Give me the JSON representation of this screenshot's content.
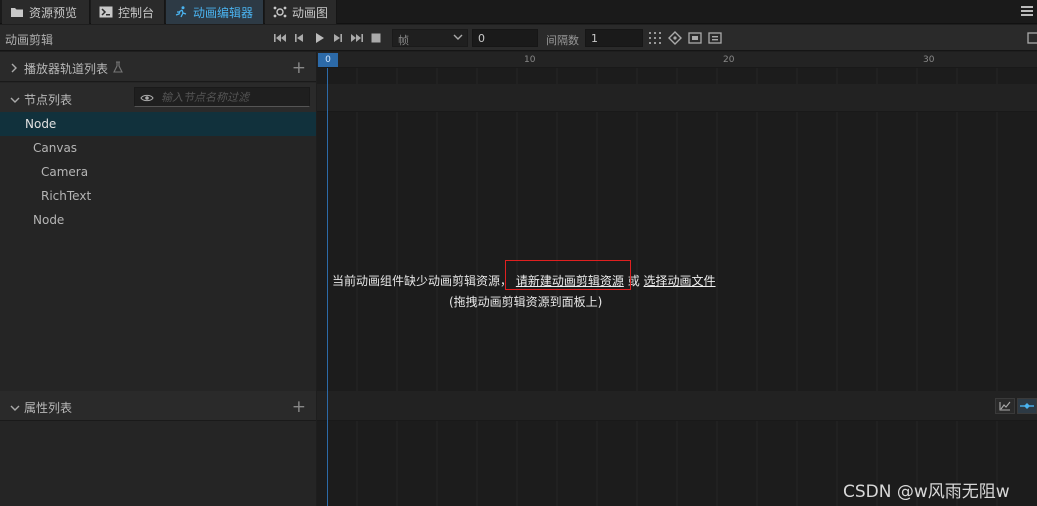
{
  "tabs": [
    {
      "label": "资源预览",
      "icon": "folder-icon"
    },
    {
      "label": "控制台",
      "icon": "terminal-icon"
    },
    {
      "label": "动画编辑器",
      "icon": "running-figure-icon",
      "active": true
    },
    {
      "label": "动画图",
      "icon": "animation-graph-icon"
    }
  ],
  "toolbar": {
    "title": "动画剪辑",
    "unit_select": "帧",
    "frame_value": "0",
    "interval_label": "间隔数",
    "interval_value": "1"
  },
  "panels": {
    "track_list": "播放器轨道列表",
    "node_list": "节点列表",
    "filter_placeholder": "输入节点名称过滤",
    "property_list": "属性列表"
  },
  "nodes": [
    {
      "label": "Node",
      "selected": true
    },
    {
      "label": "Canvas"
    },
    {
      "label": "Camera"
    },
    {
      "label": "RichText"
    },
    {
      "label": "Node"
    }
  ],
  "ruler": {
    "playhead": "0",
    "ticks": [
      "10",
      "20",
      "30"
    ]
  },
  "message": {
    "prefix": "当前动画组件缺少动画剪辑资源，",
    "link_new": "请新建动画剪辑资源",
    "or": "或",
    "link_select": "选择动画文件",
    "sub": "(拖拽动画剪辑资源到面板上)"
  },
  "watermark": "CSDN @w风雨无阻w",
  "colors": {
    "accent": "#4ab3f0",
    "selected_row": "#11313c",
    "highlight_box": "#e02020",
    "playhead": "#2c6aa8"
  }
}
